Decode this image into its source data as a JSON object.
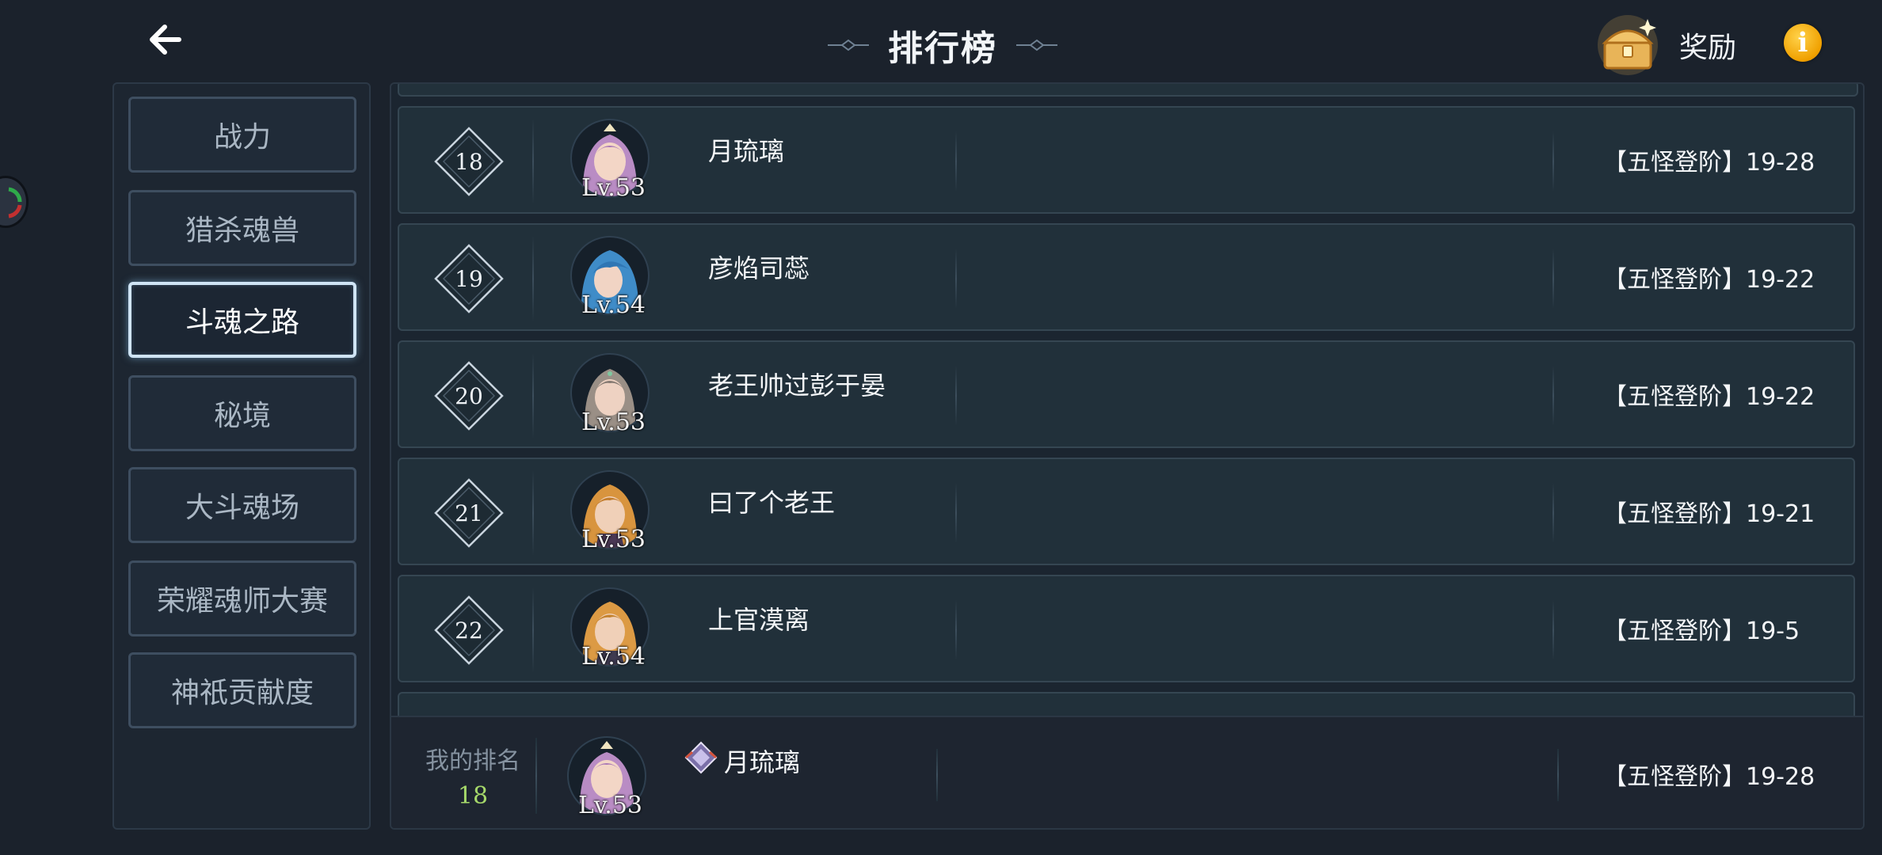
{
  "header": {
    "title": "排行榜",
    "reward_label": "奖励",
    "info_label": "i"
  },
  "sidebar": {
    "items": [
      {
        "label": "战力",
        "active": false
      },
      {
        "label": "猎杀魂兽",
        "active": false
      },
      {
        "label": "斗魂之路",
        "active": true
      },
      {
        "label": "秘境",
        "active": false
      },
      {
        "label": "大斗魂场",
        "active": false
      },
      {
        "label": "荣耀魂师大赛",
        "active": false
      },
      {
        "label": "神祇贡献度",
        "active": false
      }
    ]
  },
  "ranking": {
    "rows": [
      {
        "rank": "18",
        "level": "Lv.53",
        "name": "月琉璃",
        "score": "【五怪登阶】19-28",
        "avatar": "purple-hair"
      },
      {
        "rank": "19",
        "level": "Lv.54",
        "name": "彦焰司蕊",
        "score": "【五怪登阶】19-22",
        "avatar": "blue-hair"
      },
      {
        "rank": "20",
        "level": "Lv.53",
        "name": "老王帅过彭于晏",
        "score": "【五怪登阶】19-22",
        "avatar": "grey-hair"
      },
      {
        "rank": "21",
        "level": "Lv.53",
        "name": "曰了个老王",
        "score": "【五怪登阶】19-21",
        "avatar": "blonde-hair"
      },
      {
        "rank": "22",
        "level": "Lv.54",
        "name": "上官漠离",
        "score": "【五怪登阶】19-5",
        "avatar": "blonde-hair"
      }
    ]
  },
  "my_rank": {
    "label": "我的排名",
    "rank": "18",
    "level": "Lv.53",
    "name": "月琉璃",
    "score": "【五怪登阶】19-28",
    "avatar": "purple-hair"
  },
  "colors": {
    "background": "#1b222c",
    "row_bg": "#21303a",
    "accent_green": "#a6d96a",
    "info_orange": "#f0a000"
  }
}
